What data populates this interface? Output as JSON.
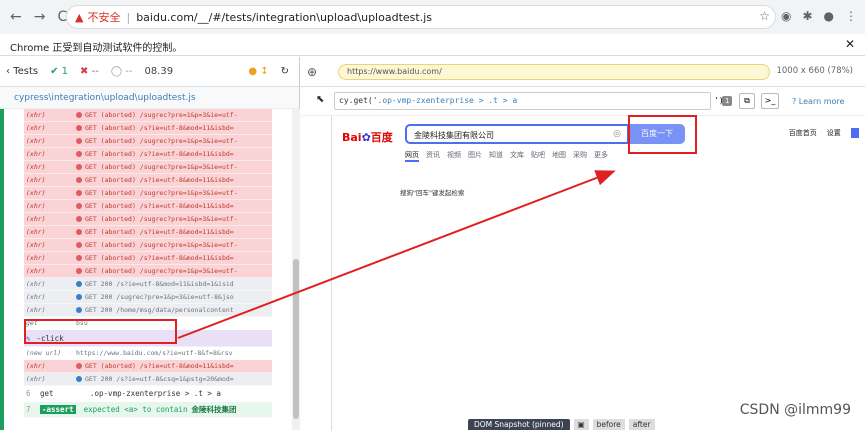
{
  "browser": {
    "back": "←",
    "forward": "→",
    "reload": "C",
    "security_warning": "▲",
    "security_label": "不安全",
    "url": "baidu.com/__/#/tests/integration\\upload\\uploadtest.js",
    "infobar_text": "Chrome 正受到自动测试软件的控制。",
    "infobar_close": "✕"
  },
  "reporter": {
    "tests_label": "Tests",
    "passed_mark": "✔",
    "passed": "1",
    "failed_mark": "✖",
    "failed": "--",
    "pending_mark": "◯",
    "pending": "--",
    "duration": "08.39",
    "spec_path": "cypress\\integration\\upload\\uploadtest.js",
    "commands": [
      {
        "type": "red",
        "label": "(xhr)",
        "text": "GET (aborted) /sugrec?pre=1&p=3&ie=utf-"
      },
      {
        "type": "red",
        "label": "(xhr)",
        "text": "GET (aborted) /s?ie=utf-8&mod=11&isbd="
      },
      {
        "type": "red",
        "label": "(xhr)",
        "text": "GET (aborted) /sugrec?pre=1&p=3&ie=utf-"
      },
      {
        "type": "red",
        "label": "(xhr)",
        "text": "GET (aborted) /s?ie=utf-8&mod=11&isbd="
      },
      {
        "type": "red",
        "label": "(xhr)",
        "text": "GET (aborted) /sugrec?pre=1&p=3&ie=utf-"
      },
      {
        "type": "red",
        "label": "(xhr)",
        "text": "GET (aborted) /s?ie=utf-8&mod=11&isbd="
      },
      {
        "type": "red",
        "label": "(xhr)",
        "text": "GET (aborted) /sugrec?pre=1&p=3&ie=utf-"
      },
      {
        "type": "red",
        "label": "(xhr)",
        "text": "GET (aborted) /s?ie=utf-8&mod=11&isbd="
      },
      {
        "type": "red",
        "label": "(xhr)",
        "text": "GET (aborted) /sugrec?pre=1&p=3&ie=utf-"
      },
      {
        "type": "red",
        "label": "(xhr)",
        "text": "GET (aborted) /s?ie=utf-8&mod=11&isbd="
      },
      {
        "type": "red",
        "label": "(xhr)",
        "text": "GET (aborted) /sugrec?pre=1&p=3&ie=utf-"
      },
      {
        "type": "red",
        "label": "(xhr)",
        "text": "GET (aborted) /s?ie=utf-8&mod=11&isbd="
      },
      {
        "type": "red",
        "label": "(xhr)",
        "text": "GET (aborted) /sugrec?pre=1&p=3&ie=utf-"
      },
      {
        "type": "grey",
        "label": "(xhr)",
        "text": "GET 200 /s?ie=utf-8&mod=11&isbd=1&isid"
      },
      {
        "type": "grey",
        "label": "(xhr)",
        "text": "GET 200 /sugrec?pre=1&p=3&ie=utf-8&jso"
      },
      {
        "type": "grey",
        "label": "(xhr)",
        "text": "GET 200 /home/msg/data/personalcontent"
      }
    ],
    "get_label": "get",
    "get_value": "bsu",
    "click_pin": "✎",
    "click_label": "-click",
    "new_url_label": "(new url)",
    "new_url_value": "https://www.baidu.com/s?ie=utf-8&f=8&rsv",
    "after_commands": [
      {
        "type": "red",
        "label": "(xhr)",
        "text": "GET (aborted) /s?ie=utf-8&mod=11&isbd="
      },
      {
        "type": "grey",
        "label": "(xhr)",
        "text": "GET 200 /s?ie=utf-8&csq=1&pstg=20&mod="
      }
    ],
    "step6_num": "6",
    "step6_cmd": "get",
    "step6_value": ".op-vmp-zxenterprise > .t > a",
    "step7_num": "7",
    "step7_badge": "-assert",
    "step7_text": "expected <a> to contain",
    "step7_value": "金陵科技集团"
  },
  "aut": {
    "url": "https://www.baidu.com/",
    "viewport": "1000 x 660",
    "zoom": "(78%)",
    "selector_cmd": "cy.get('",
    "selector_value": ".op-vmp-zxenterprise > .t > a",
    "selector_end": "')",
    "match_count": "1",
    "learn_more": "Learn more",
    "baidu_logo_a": "Bai",
    "baidu_logo_b": "百度",
    "search_value": "金陵科技集团有限公司",
    "search_button": "百度一下",
    "topnav": [
      "百度首页",
      "设置"
    ],
    "tabs": [
      "网页",
      "资讯",
      "视频",
      "图片",
      "知道",
      "文库",
      "贴吧",
      "地图",
      "采购",
      "更多"
    ],
    "result_tip": "搜狗\"回车\"键发起检索",
    "snapshot_label": "DOM Snapshot (pinned)",
    "before": "before",
    "after": "after"
  },
  "watermark": "CSDN @ilmm99"
}
